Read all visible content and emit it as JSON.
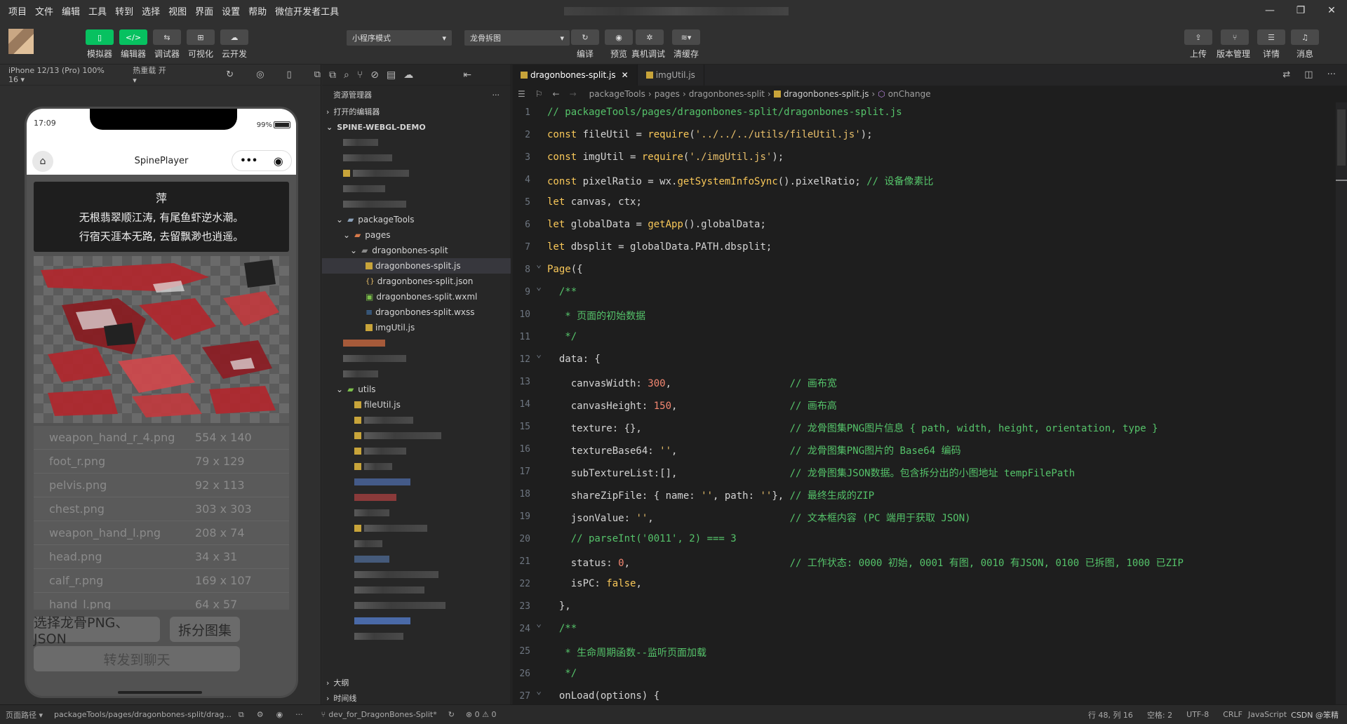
{
  "menu": [
    "项目",
    "文件",
    "编辑",
    "工具",
    "转到",
    "选择",
    "视图",
    "界面",
    "设置",
    "帮助",
    "微信开发者工具"
  ],
  "toolbar": {
    "left_buttons": [
      {
        "label": "模拟器",
        "icon": "phone-icon"
      },
      {
        "label": "编辑器",
        "icon": "code-icon"
      },
      {
        "label": "调试器",
        "icon": "debug-icon"
      },
      {
        "label": "可视化",
        "icon": "layout-icon"
      },
      {
        "label": "云开发",
        "icon": "cloud-icon"
      }
    ],
    "mode_select": "小程序模式",
    "compile_select": "龙骨拆图",
    "mid_buttons": [
      {
        "label": "编译",
        "icon": "refresh-icon"
      },
      {
        "label": "预览",
        "icon": "eye-icon"
      },
      {
        "label": "真机调试",
        "icon": "bug-icon"
      },
      {
        "label": "清缓存",
        "icon": "layers-icon"
      }
    ],
    "right_buttons": [
      {
        "label": "上传",
        "icon": "upload-icon"
      },
      {
        "label": "版本管理",
        "icon": "branch-icon"
      },
      {
        "label": "详情",
        "icon": "menu-icon"
      },
      {
        "label": "消息",
        "icon": "bell-icon"
      }
    ]
  },
  "simulator": {
    "device": "iPhone 12/13 (Pro) 100% 16 ▾",
    "hot_reload": "热重载 开 ▾",
    "time": "17:09",
    "battery": "99%",
    "page_title": "SpinePlayer",
    "message_lines": [
      "萍",
      "无根翡翠顺江涛, 有尾鱼虾逆水潮。",
      "行宿天涯本无路, 去留飘渺也逍遥。"
    ],
    "files": [
      {
        "name": "weapon_hand_r_4.png",
        "size": "554 x 140"
      },
      {
        "name": "foot_r.png",
        "size": "79 x 129"
      },
      {
        "name": "pelvis.png",
        "size": "92 x 113"
      },
      {
        "name": "chest.png",
        "size": "303 x 303"
      },
      {
        "name": "weapon_hand_l.png",
        "size": "208 x 74"
      },
      {
        "name": "head.png",
        "size": "34 x 31"
      },
      {
        "name": "calf_r.png",
        "size": "169 x 107"
      },
      {
        "name": "hand_l.png",
        "size": "64 x 57"
      }
    ],
    "btn_select": "选择龙骨PNG、JSON",
    "btn_split": "拆分图集",
    "btn_share": "转发到聊天"
  },
  "explorer": {
    "title": "资源管理器",
    "open_editors": "打开的编辑器",
    "project": "SPINE-WEBGL-DEMO",
    "tree": {
      "packageTools": "packageTools",
      "pages": "pages",
      "dragonbones_split": "dragonbones-split",
      "files": [
        "dragonbones-split.js",
        "dragonbones-split.json",
        "dragonbones-split.wxml",
        "dragonbones-split.wxss",
        "imgUtil.js"
      ],
      "utils": "utils",
      "fileUtil": "fileUtil.js"
    },
    "outline": "大纲",
    "timeline": "时间线"
  },
  "editor": {
    "tabs": [
      "dragonbones-split.js",
      "imgUtil.js"
    ],
    "breadcrumb": [
      "packageTools",
      "pages",
      "dragonbones-split",
      "dragonbones-split.js",
      "onChange"
    ],
    "lines": [
      "// packageTools/pages/dragonbones-split/dragonbones-split.js",
      "const fileUtil = require('../../../utils/fileUtil.js');",
      "const imgUtil = require('./imgUtil.js');",
      "const pixelRatio = wx.getSystemInfoSync().pixelRatio; // 设备像素比",
      "let canvas, ctx;",
      "let globalData = getApp().globalData;",
      "let dbsplit = globalData.PATH.dbsplit;",
      "Page({",
      "  /**",
      "   * 页面的初始数据",
      "   */",
      "  data: {",
      "    canvasWidth: 300,                    // 画布宽",
      "    canvasHeight: 150,                   // 画布高",
      "    texture: {},                         // 龙骨图集PNG图片信息 { path, width, height, orientation, type }",
      "    textureBase64: '',                   // 龙骨图集PNG图片的 Base64 编码",
      "    subTextureList:[],                   // 龙骨图集JSON数据。包含拆分出的小图地址 tempFilePath",
      "    shareZipFile: { name: '', path: ''}, // 最终生成的ZIP",
      "    jsonValue: '',                       // 文本框内容 (PC 端用于获取 JSON)",
      "    // parseInt('0011', 2) === 3",
      "    status: 0,                           // 工作状态: 0000 初始, 0001 有图, 0010 有JSON, 0100 已拆图, 1000 已ZIP",
      "    isPC: false,",
      "  },",
      "  /**",
      "   * 生命周期函数--监听页面加载",
      "   */",
      "  onLoad(options) {"
    ]
  },
  "status": {
    "page_path_label": "页面路径 ▾",
    "page_path": "packageTools/pages/dragonbones-split/drag...",
    "branch": "dev_for_DragonBones-Split*",
    "errors": "⊗ 0 ⚠ 0",
    "position": "行 48, 列 16",
    "spaces": "空格: 2",
    "encoding": "UTF-8",
    "eol": "CRLF",
    "lang": "JavaScript",
    "watermark": "CSDN @笨精"
  }
}
